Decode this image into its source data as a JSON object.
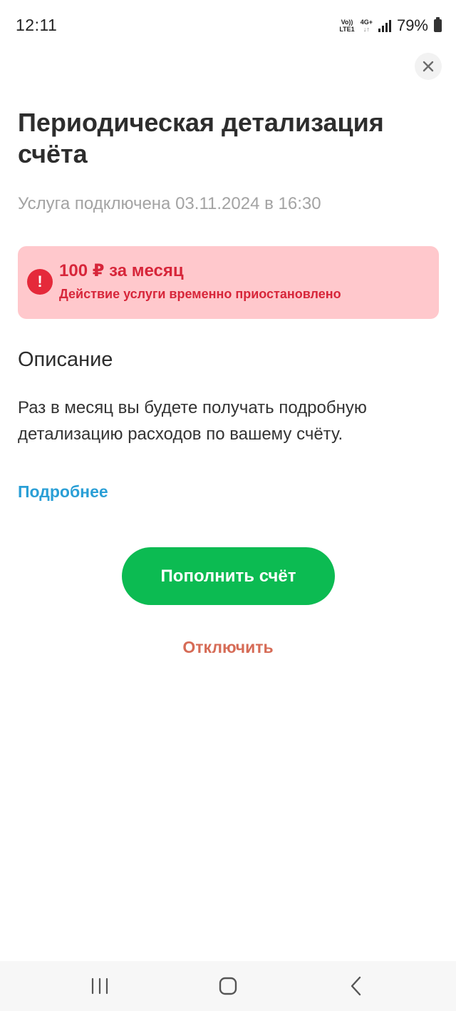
{
  "status_bar": {
    "time": "12:11",
    "volte_top": "Vo))",
    "volte_bottom": "LTE1",
    "network": "4G+",
    "network_arrows": "↓↑",
    "battery": "79%"
  },
  "header": {
    "close_icon": "close-icon"
  },
  "service": {
    "title": "Периодическая детализация счёта",
    "subtitle": "Услуга подключена 03.11.2024 в 16:30"
  },
  "alert": {
    "icon": "!",
    "price": "100 ₽ за месяц",
    "message": "Действие услуги временно приостановлено",
    "colors": {
      "background": "#ffc8cc",
      "text": "#d7263a"
    }
  },
  "description": {
    "title": "Описание",
    "text": "Раз в месяц вы будете получать подробную детализацию расходов по вашему счёту.",
    "more_link": "Подробнее"
  },
  "actions": {
    "topup_label": "Пополнить счёт",
    "disable_label": "Отключить",
    "colors": {
      "primary": "#0cbb52",
      "danger_link": "#d66b56",
      "link": "#2a9fd6"
    }
  },
  "nav_bar": {
    "recents_icon": "recents-icon",
    "home_icon": "home-icon",
    "back_icon": "back-icon"
  }
}
